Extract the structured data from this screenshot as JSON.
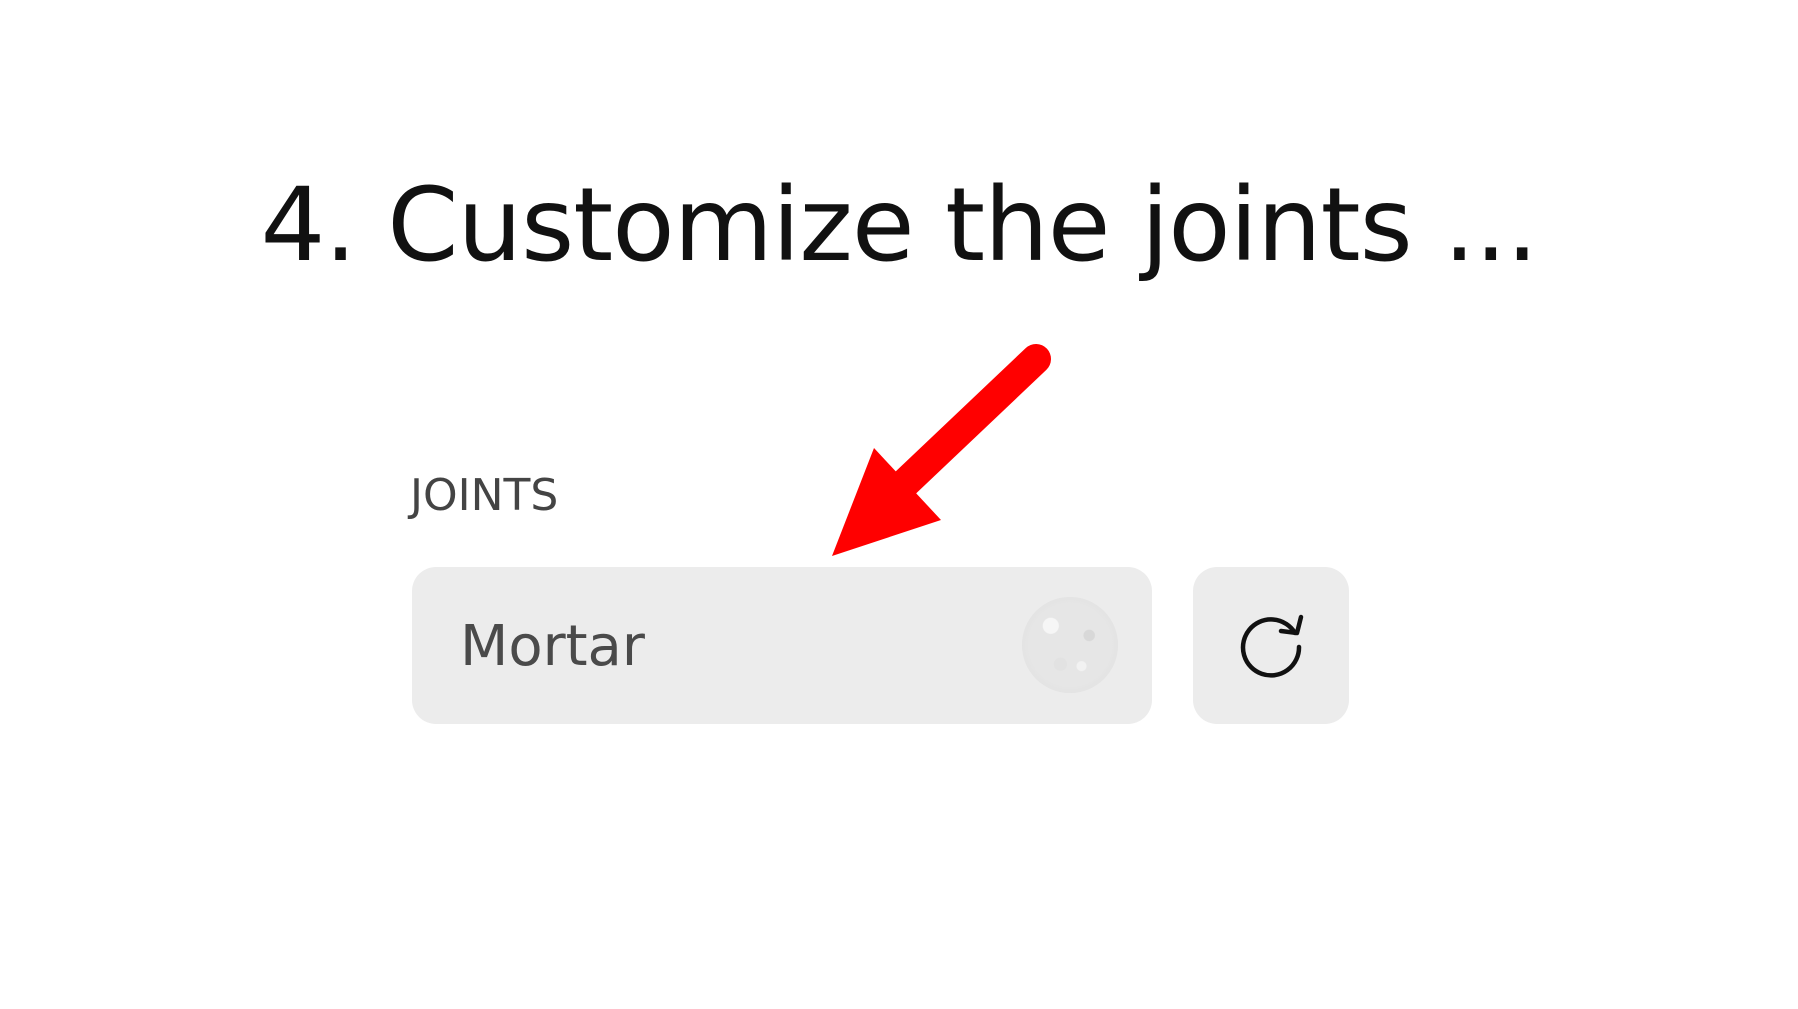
{
  "heading": "4. Customize the joints ...",
  "joints": {
    "label": "JOINTS",
    "selected_value": "Mortar",
    "swatch_icon": "mortar-texture-swatch",
    "reset_icon": "refresh-icon"
  },
  "annotation": {
    "icon": "red-arrow-pointer",
    "color": "#ff0000"
  }
}
